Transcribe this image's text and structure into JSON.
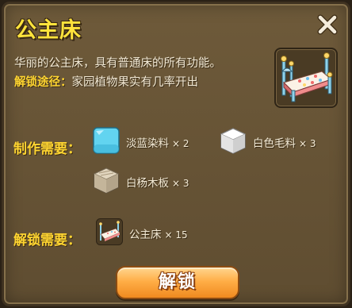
{
  "dialog": {
    "title": "公主床",
    "description": "华丽的公主床，具有普通床的所有功能。",
    "unlock_path_label": "解锁途径：",
    "unlock_path_value": "家园植物果实有几率开出"
  },
  "crafting": {
    "label": "制作需要：",
    "materials": [
      {
        "name": "淡蓝染料",
        "qty": "× 2",
        "icon": "light-blue-dye-icon",
        "color": "#62d4f0"
      },
      {
        "name": "白色毛料",
        "qty": "× 3",
        "icon": "white-wool-icon",
        "color": "#ececec"
      },
      {
        "name": "白杨木板",
        "qty": "× 3",
        "icon": "poplar-plank-icon",
        "color": "#cdbfa6"
      }
    ]
  },
  "unlock": {
    "label": "解锁需要：",
    "item": {
      "name": "公主床",
      "qty": "× 15",
      "icon": "princess-bed-icon"
    }
  },
  "button": {
    "label": "解锁"
  },
  "colors": {
    "title": "#ffe33c",
    "label": "#ffd531",
    "panel": "#6e5a3a",
    "button": "#ffae47"
  }
}
